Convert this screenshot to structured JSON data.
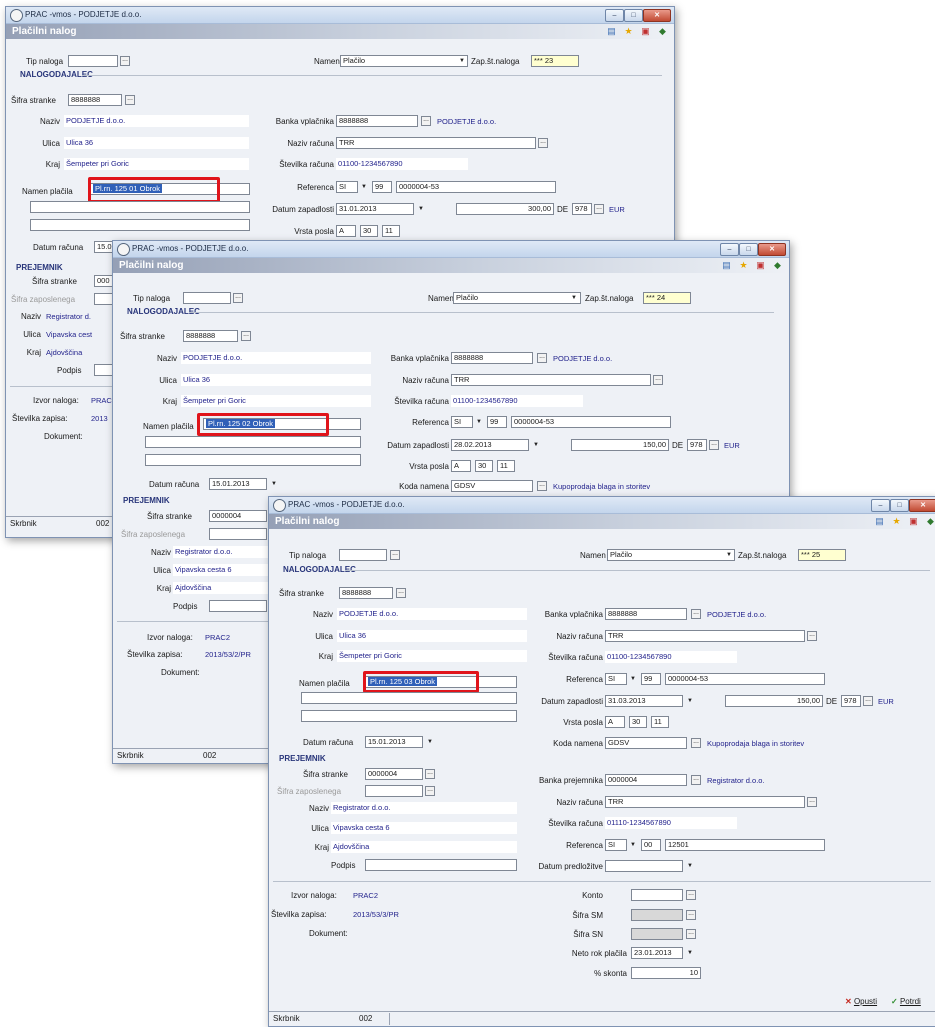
{
  "windows": [
    {
      "title": "PRAC -vmos - PODJETJE d.o.o.",
      "form_title": "Plačilni nalog",
      "tip_naloga_label": "Tip naloga",
      "namen_label": "Namen",
      "namen_value": "Plačilo",
      "zap_label": "Zap.št.naloga",
      "zap_value": "*** 23",
      "nalogodajalec": {
        "section": "NALOGODAJALEC",
        "sifra_label": "Šifra stranke",
        "sifra_value": "8888888",
        "naziv_label": "Naziv",
        "naziv_value": "PODJETJE d.o.o.",
        "ulica_label": "Ulica",
        "ulica_value": "Ulica 36",
        "kraj_label": "Kraj",
        "kraj_value": "Šempeter pri Goric",
        "namen_placila_label": "Namen plačila",
        "namen_placila_value": "Pl.rn. 125 01 Obrok"
      },
      "banka_label": "Banka vplačnika",
      "banka_value": "8888888",
      "banka_name": "PODJETJE d.o.o.",
      "naziv_racuna_label": "Naziv računa",
      "naziv_racuna_value": "TRR",
      "stevilka_racuna_label": "Številka računa",
      "stevilka_racuna_value": "01100-1234567890",
      "referenca_label": "Referenca",
      "referenca_si": "SI",
      "referenca_model": "99",
      "referenca_value": "0000004-53",
      "datum_zapadlosti_label": "Datum zapadlosti",
      "datum_zapadlosti_value": "31.01.2013",
      "znesek": "300,00",
      "valuta_code": "DE",
      "valuta_num": "978",
      "valuta": "EUR",
      "vrsta_posla_label": "Vrsta posla",
      "vrsta_posla": [
        "A",
        "30",
        "11"
      ],
      "datum_racuna_label": "Datum računa",
      "datum_racuna_value": "15.0",
      "prejemnik": {
        "section": "PREJEMNIK",
        "sifra_label": "Šifra stranke",
        "sifra_value": "000",
        "sifra_zaposlenega_label": "Šifra zaposlenega",
        "naziv_label": "Naziv",
        "naziv_value": "Registrator d.",
        "ulica_label": "Ulica",
        "ulica_value": "Vipavska cest",
        "kraj_label": "Kraj",
        "kraj_value": "Ajdovščina",
        "podpis_label": "Podpis"
      },
      "izvor_label": "Izvor naloga:",
      "izvor_value": "PRAC",
      "stevilka_zapisa_label": "Številka zapisa:",
      "stevilka_zapisa_value": "2013",
      "dokument_label": "Dokument:",
      "status_label": "Skrbnik",
      "status_user": "002"
    },
    {
      "title": "PRAC -vmos - PODJETJE d.o.o.",
      "form_title": "Plačilni nalog",
      "tip_naloga_label": "Tip naloga",
      "namen_label": "Namen",
      "namen_value": "Plačilo",
      "zap_label": "Zap.št.naloga",
      "zap_value": "*** 24",
      "nalogodajalec": {
        "section": "NALOGODAJALEC",
        "sifra_label": "Šifra stranke",
        "sifra_value": "8888888",
        "naziv_label": "Naziv",
        "naziv_value": "PODJETJE d.o.o.",
        "ulica_label": "Ulica",
        "ulica_value": "Ulica 36",
        "kraj_label": "Kraj",
        "kraj_value": "Šempeter pri Goric",
        "namen_placila_label": "Namen plačila",
        "namen_placila_value": "Pl.rn. 125 02 Obrok"
      },
      "banka_label": "Banka vplačnika",
      "banka_value": "8888888",
      "banka_name": "PODJETJE d.o.o.",
      "naziv_racuna_label": "Naziv računa",
      "naziv_racuna_value": "TRR",
      "stevilka_racuna_label": "Številka računa",
      "stevilka_racuna_value": "01100-1234567890",
      "referenca_label": "Referenca",
      "referenca_si": "SI",
      "referenca_model": "99",
      "referenca_value": "0000004-53",
      "datum_zapadlosti_label": "Datum zapadlosti",
      "datum_zapadlosti_value": "28.02.2013",
      "znesek": "150,00",
      "valuta_code": "DE",
      "valuta_num": "978",
      "valuta": "EUR",
      "vrsta_posla_label": "Vrsta posla",
      "vrsta_posla": [
        "A",
        "30",
        "11"
      ],
      "koda_namena_label": "Koda namena",
      "koda_namena_value": "GDSV",
      "koda_namena_desc": "Kupoprodaja blaga in storitev",
      "datum_racuna_label": "Datum računa",
      "datum_racuna_value": "15.01.2013",
      "prejemnik": {
        "section": "PREJEMNIK",
        "sifra_label": "Šifra stranke",
        "sifra_value": "0000004",
        "sifra_zaposlenega_label": "Šifra zaposlenega",
        "naziv_label": "Naziv",
        "naziv_value": "Registrator d.o.o.",
        "ulica_label": "Ulica",
        "ulica_value": "Vipavska cesta 6",
        "kraj_label": "Kraj",
        "kraj_value": "Ajdovščina",
        "podpis_label": "Podpis"
      },
      "izvor_label": "Izvor naloga:",
      "izvor_value": "PRAC2",
      "stevilka_zapisa_label": "Številka zapisa:",
      "stevilka_zapisa_value": "2013/53/2/PR",
      "dokument_label": "Dokument:",
      "status_label": "Skrbnik",
      "status_user": "002"
    },
    {
      "title": "PRAC -vmos - PODJETJE d.o.o.",
      "form_title": "Plačilni nalog",
      "tip_naloga_label": "Tip naloga",
      "namen_label": "Namen",
      "namen_value": "Plačilo",
      "zap_label": "Zap.št.naloga",
      "zap_value": "*** 25",
      "nalogodajalec": {
        "section": "NALOGODAJALEC",
        "sifra_label": "Šifra stranke",
        "sifra_value": "8888888",
        "naziv_label": "Naziv",
        "naziv_value": "PODJETJE d.o.o.",
        "ulica_label": "Ulica",
        "ulica_value": "Ulica 36",
        "kraj_label": "Kraj",
        "kraj_value": "Šempeter pri Goric",
        "namen_placila_label": "Namen plačila",
        "namen_placila_value": "Pl.rn. 125 03 Obrok"
      },
      "banka_label": "Banka vplačnika",
      "banka_value": "8888888",
      "banka_name": "PODJETJE d.o.o.",
      "naziv_racuna_label": "Naziv računa",
      "naziv_racuna_value": "TRR",
      "stevilka_racuna_label": "Številka računa",
      "stevilka_racuna_value": "01100-1234567890",
      "referenca_label": "Referenca",
      "referenca_si": "SI",
      "referenca_model": "99",
      "referenca_value": "0000004-53",
      "datum_zapadlosti_label": "Datum zapadlosti",
      "datum_zapadlosti_value": "31.03.2013",
      "znesek": "150,00",
      "valuta_code": "DE",
      "valuta_num": "978",
      "valuta": "EUR",
      "vrsta_posla_label": "Vrsta posla",
      "vrsta_posla": [
        "A",
        "30",
        "11"
      ],
      "koda_namena_label": "Koda namena",
      "koda_namena_value": "GDSV",
      "koda_namena_desc": "Kupoprodaja blaga in storitev",
      "datum_racuna_label": "Datum računa",
      "datum_racuna_value": "15.01.2013",
      "prejemnik": {
        "section": "PREJEMNIK",
        "sifra_label": "Šifra stranke",
        "sifra_value": "0000004",
        "sifra_zaposlenega_label": "Šifra zaposlenega",
        "naziv_label": "Naziv",
        "naziv_value": "Registrator d.o.o.",
        "ulica_label": "Ulica",
        "ulica_value": "Vipavska cesta 6",
        "kraj_label": "Kraj",
        "kraj_value": "Ajdovščina",
        "podpis_label": "Podpis"
      },
      "banka_prejemnika_label": "Banka prejemnika",
      "banka_prejemnika_value": "0000004",
      "banka_prejemnika_name": "Registrator d.o.o.",
      "prej_naziv_racuna_label": "Naziv računa",
      "prej_naziv_racuna_value": "TRR",
      "prej_stevilka_racuna_label": "Številka računa",
      "prej_stevilka_racuna_value": "01110-1234567890",
      "prej_referenca_label": "Referenca",
      "prej_referenca_si": "SI",
      "prej_referenca_model": "00",
      "prej_referenca_value": "12501",
      "datum_predlozitve_label": "Datum predložitve",
      "izvor_label": "Izvor naloga:",
      "izvor_value": "PRAC2",
      "stevilka_zapisa_label": "Številka zapisa:",
      "stevilka_zapisa_value": "2013/53/3/PR",
      "dokument_label": "Dokument:",
      "konto_label": "Konto",
      "sifra_sm_label": "Šifra SM",
      "sifra_sn_label": "Šifra SN",
      "neto_rok_label": "Neto rok plačila",
      "neto_rok_value": "23.01.2013",
      "skonto_label": "% skonta",
      "skonto_value": "10",
      "cancel_label": "Opusti",
      "confirm_label": "Potrdi",
      "status_label": "Skrbnik",
      "status_user": "002"
    }
  ],
  "colors": {
    "highlight_box": "#e0141b",
    "selection": "#3060b8",
    "link_text": "#23238c"
  }
}
